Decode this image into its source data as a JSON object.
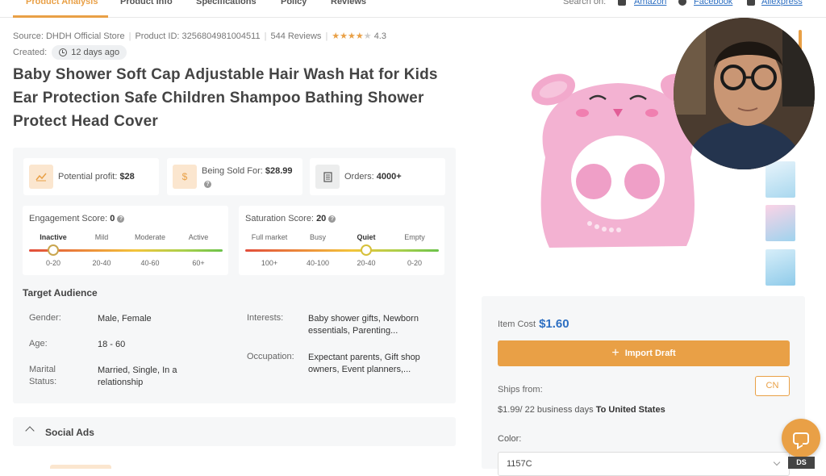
{
  "tabs": [
    {
      "label": "Product Analysis",
      "active": true
    },
    {
      "label": "Product Info"
    },
    {
      "label": "Specifications"
    },
    {
      "label": "Policy"
    },
    {
      "label": "Reviews"
    }
  ],
  "search": {
    "label": "Search on:",
    "links": [
      {
        "label": "Amazon",
        "icon": "amazon-icon"
      },
      {
        "label": "Facebook",
        "icon": "facebook-icon"
      },
      {
        "label": "Aliexpress",
        "icon": "aliexpress-icon"
      }
    ]
  },
  "meta": {
    "source": "Source: DHDH Official Store",
    "product_id": "Product ID: 3256804981004511",
    "reviews": "544 Reviews",
    "rating": "4.3",
    "stars": 4.3,
    "created_label": "Created:",
    "created_value": "12 days ago"
  },
  "product_title": "Baby Shower Soft Cap Adjustable Hair Wash Hat for Kids Ear Protection Safe Children Shampoo Bathing Shower Protect Head Cover",
  "stats": {
    "profit_label": "Potential profit:",
    "profit_value": "$28",
    "sold_label": "Being Sold For:",
    "sold_value": "$28.99",
    "orders_label": "Orders:",
    "orders_value": "4000+"
  },
  "engagement": {
    "label": "Engagement Score:",
    "value": "0",
    "levels": [
      "Inactive",
      "Mild",
      "Moderate",
      "Active"
    ],
    "ranges": [
      "0-20",
      "20-40",
      "40-60",
      "60+"
    ],
    "selected_index": 0
  },
  "saturation": {
    "label": "Saturation Score:",
    "value": "20",
    "levels": [
      "Full market",
      "Busy",
      "Quiet",
      "Empty"
    ],
    "ranges": [
      "100+",
      "40-100",
      "20-40",
      "0-20"
    ],
    "selected_index": 2
  },
  "audience": {
    "title": "Target Audience",
    "gender_label": "Gender:",
    "gender_value": "Male, Female",
    "age_label": "Age:",
    "age_value": "18 - 60",
    "marital_label_1": "Marital",
    "marital_label_2": "Status:",
    "marital_value_1": "Married, Single, In a",
    "marital_value_2": "relationship",
    "interests_label": "Interests:",
    "interests_value_1": "Baby shower gifts, Newborn",
    "interests_value_2": "essentials, Parenting...",
    "occupation_label": "Occupation:",
    "occupation_value_1": "Expectant parents, Gift shop",
    "occupation_value_2": "owners, Event planners,..."
  },
  "social_ads_label": "Social Ads",
  "buy": {
    "item_cost_label": "Item Cost",
    "item_cost_value": "$1.60",
    "import_label": "Import Draft",
    "ships_from_label": "Ships from:",
    "ships_from_value": "CN",
    "shipping_price": "$1.99",
    "shipping_days": "/ 22 business days",
    "shipping_dest": "To United States",
    "color_label": "Color:",
    "color_value": "1157C"
  },
  "badge_label": "DS",
  "colors": {
    "accent": "#e9a046",
    "link": "#2d6fc2",
    "panel": "#f6f7f8",
    "product_pink": "#f3b2d2"
  }
}
